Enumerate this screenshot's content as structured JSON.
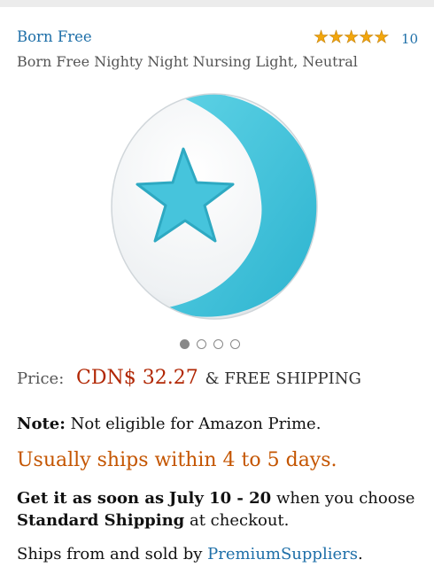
{
  "product": {
    "brand": "Born Free",
    "rating_stars": 5,
    "review_count": "10",
    "title": "Born Free Nighty Night Nursing Light, Neutral",
    "image_icon": "moon-star-nightlight",
    "image_carousel": {
      "count": 4,
      "active_index": 0
    }
  },
  "price": {
    "label": "Price:",
    "value": "CDN$ 32.27",
    "shipping": "& FREE SHIPPING"
  },
  "note": {
    "label": "Note:",
    "text": "Not eligible for Amazon Prime."
  },
  "availability": "Usually ships within 4 to 5 days.",
  "delivery": {
    "prefix": "Get it as soon as",
    "dates": "July 10 - 20",
    "middle": "when you choose",
    "method": "Standard Shipping",
    "suffix": "at checkout."
  },
  "seller": {
    "prefix": "Ships from and sold by",
    "name": "PremiumSuppliers",
    "suffix": "."
  },
  "colors": {
    "link": "#1e6fa8",
    "price": "#b12704",
    "availability": "#c45500",
    "star": "#f2a60c",
    "nightlight_blue": "#3cc3dc"
  }
}
